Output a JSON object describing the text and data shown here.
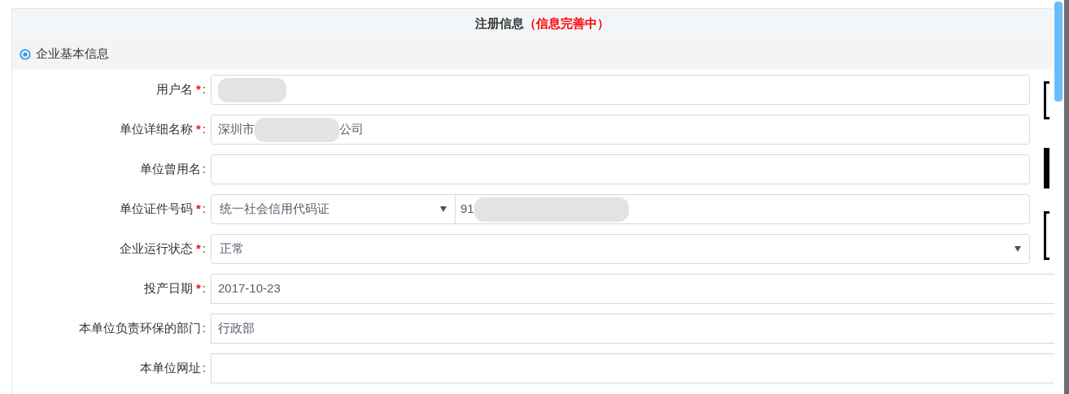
{
  "header": {
    "title": "注册信息",
    "status": "（信息完善中）"
  },
  "section": {
    "title": "企业基本信息"
  },
  "fields": [
    {
      "label": "用户名",
      "required_mark": "*",
      "colon": ":",
      "kind": "text",
      "segments": [
        {
          "kind": "blur"
        }
      ]
    },
    {
      "label": "单位详细名称",
      "required_mark": "*",
      "colon": ":",
      "kind": "text",
      "segments": [
        {
          "kind": "text",
          "text": "深圳市"
        },
        {
          "kind": "blur"
        },
        {
          "kind": "text",
          "text": "公司"
        }
      ]
    },
    {
      "label": "单位曾用名",
      "colon": ":",
      "kind": "text"
    },
    {
      "label": "单位证件号码",
      "required_mark": "*",
      "colon": ":",
      "kind": "select-text",
      "select_value": "统一社会信用代码证",
      "segments": [
        {
          "kind": "text",
          "text": "91"
        },
        {
          "kind": "blur"
        }
      ]
    },
    {
      "label": "企业运行状态",
      "required_mark": "*",
      "colon": ":",
      "kind": "select",
      "select_value": "正常"
    },
    {
      "label": "投产日期",
      "required_mark": "*",
      "colon": ":",
      "kind": "text",
      "segments": [
        {
          "kind": "text",
          "text": "2017-10-23"
        }
      ],
      "clipped": true
    },
    {
      "label": "本单位负责环保的部门",
      "colon": ":",
      "kind": "text",
      "segments": [
        {
          "kind": "text",
          "text": "行政部"
        }
      ],
      "clipped": true
    },
    {
      "label": "本单位网址",
      "colon": ":",
      "kind": "text",
      "clipped": true
    }
  ]
}
